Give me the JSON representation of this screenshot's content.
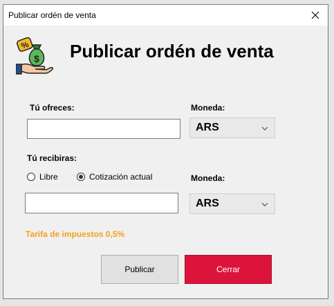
{
  "window": {
    "title": "Publicar ordén de venta"
  },
  "header": {
    "title": "Publicar ordén de venta",
    "icon": "money-bag-hand-icon"
  },
  "offer": {
    "label": "Tú ofreces:",
    "value": "",
    "currency_label": "Moneda:",
    "currency_value": "ARS"
  },
  "receive": {
    "label": "Tú recibiras:",
    "radio_free": "Libre",
    "radio_quote": "Cotización actual",
    "selected": "Cotización actual",
    "value": "",
    "currency_label": "Moneda:",
    "currency_value": "ARS"
  },
  "tax": {
    "text": "Tarifa de impuestos 0,5%",
    "color": "#f2a11d"
  },
  "buttons": {
    "publish": "Publicar",
    "close": "Cerrar",
    "close_color": "#dc143c"
  }
}
